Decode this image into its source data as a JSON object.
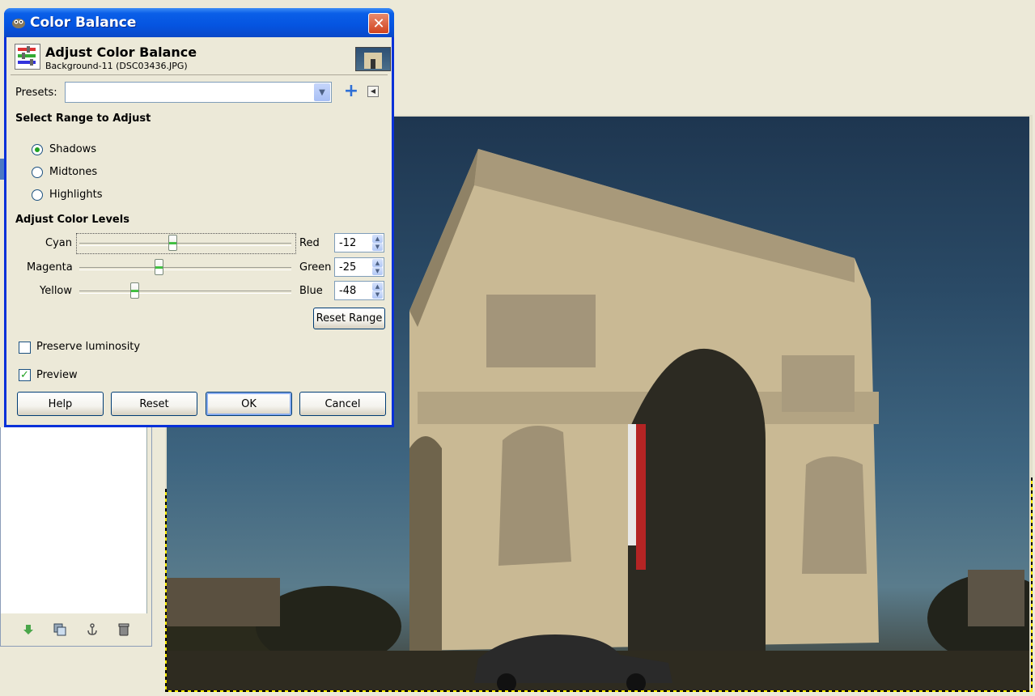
{
  "dialog": {
    "title": "Color Balance",
    "header_title": "Adjust Color Balance",
    "header_subtitle": "Background-11 (DSC03436.JPG)",
    "presets_label": "Presets:",
    "presets_value": "",
    "range_section": "Select Range to Adjust",
    "ranges": [
      {
        "label": "Shadows",
        "selected": true
      },
      {
        "label": "Midtones",
        "selected": false
      },
      {
        "label": "Highlights",
        "selected": false
      }
    ],
    "levels_section": "Adjust Color Levels",
    "levels": [
      {
        "left": "Cyan",
        "right": "Red",
        "value": "-12",
        "level": -12
      },
      {
        "left": "Magenta",
        "right": "Green",
        "value": "-25",
        "level": -25
      },
      {
        "left": "Yellow",
        "right": "Blue",
        "value": "-48",
        "level": -48
      }
    ],
    "reset_range_label": "Reset Range",
    "preserve_luminosity_label": "Preserve luminosity",
    "preserve_luminosity_checked": false,
    "preview_label": "Preview",
    "preview_checked": true,
    "buttons": {
      "help": "Help",
      "reset": "Reset",
      "ok": "OK",
      "cancel": "Cancel"
    }
  },
  "colors": {
    "title_bar": "#0554e0",
    "radio_dot": "#21a121",
    "thumb_accent": "#3fbf3f"
  }
}
